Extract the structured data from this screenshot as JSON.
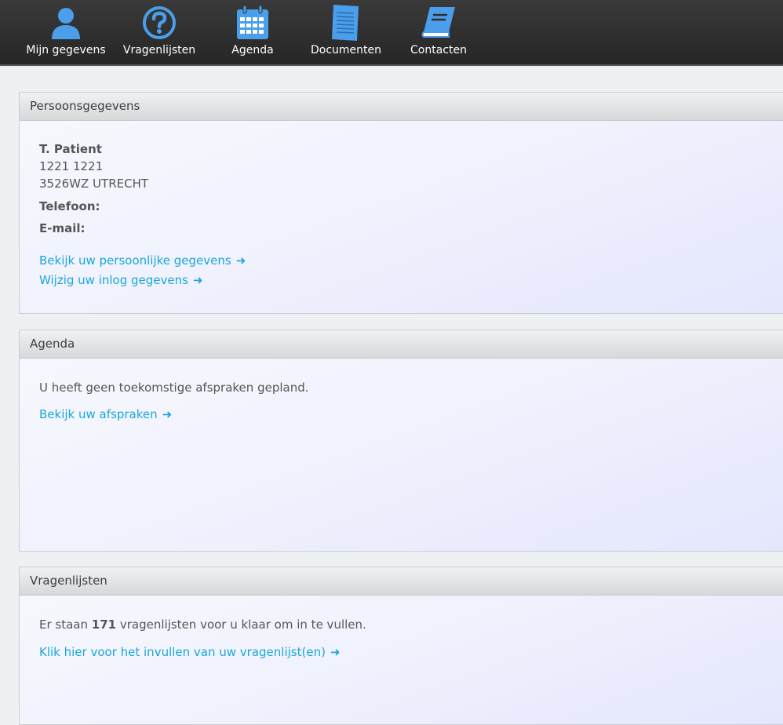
{
  "nav": {
    "items": [
      {
        "label": "Mijn gegevens",
        "icon": "user-icon"
      },
      {
        "label": "Vragenlijsten",
        "icon": "question-icon"
      },
      {
        "label": "Agenda",
        "icon": "calendar-icon"
      },
      {
        "label": "Documenten",
        "icon": "document-icon"
      },
      {
        "label": "Contacten",
        "icon": "book-icon"
      }
    ]
  },
  "personal": {
    "title": "Persoonsgegevens",
    "name": "T. Patient",
    "address_line1": "1221 1221",
    "address_line2": "3526WZ UTRECHT",
    "phone_label": "Telefoon:",
    "email_label": "E-mail:",
    "link_view": "Bekijk uw persoonlijke gegevens",
    "link_edit": "Wijzig uw inlog gegevens"
  },
  "agenda": {
    "title": "Agenda",
    "message": "U heeft geen toekomstige afspraken gepland.",
    "link_view": "Bekijk uw afspraken"
  },
  "questionnaires": {
    "title": "Vragenlijsten",
    "text_before": "Er staan",
    "count": "171",
    "text_after": "vragenlijsten voor u klaar om in te vullen.",
    "link_fill": "Klik hier voor het invullen van uw vragenlijst(en)"
  },
  "colors": {
    "accent": "#1aa7d9",
    "icon": "#4a9eea",
    "nav_bg": "#2e2e2e"
  }
}
